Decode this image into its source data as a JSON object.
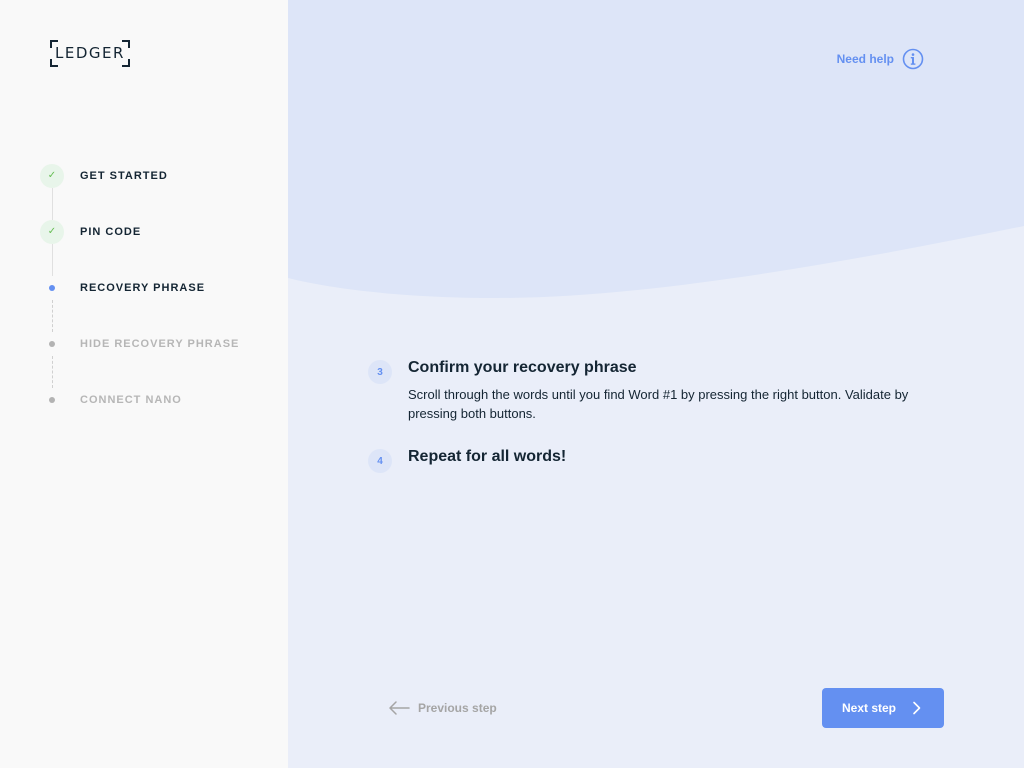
{
  "brand": {
    "logo_text": "LEDGER"
  },
  "colors": {
    "accent": "#6490f1",
    "success": "#66be54",
    "sidebar_bg": "#f9f9f9",
    "main_bg": "#eaeef9",
    "wave_bg": "#dde5f8"
  },
  "steps": [
    {
      "label": "GET STARTED",
      "state": "done",
      "icon": "check-icon"
    },
    {
      "label": "PIN CODE",
      "state": "done",
      "icon": "check-icon"
    },
    {
      "label": "RECOVERY PHRASE",
      "state": "active",
      "icon": "active-dot-icon"
    },
    {
      "label": "HIDE RECOVERY PHRASE",
      "state": "future",
      "icon": "dot-icon"
    },
    {
      "label": "CONNECT NANO",
      "state": "future",
      "icon": "dot-icon"
    }
  ],
  "header": {
    "help_label": "Need help",
    "help_icon": "info-icon"
  },
  "instructions": [
    {
      "number": "3",
      "title": "Confirm your recovery phrase",
      "description": "Scroll through the words until you find Word #1 by pressing the right button. Validate by pressing both buttons."
    },
    {
      "number": "4",
      "title": "Repeat for all words!"
    }
  ],
  "footer": {
    "previous_label": "Previous step",
    "previous_icon": "arrow-left-icon",
    "next_label": "Next step",
    "next_icon": "chevron-right-icon"
  }
}
